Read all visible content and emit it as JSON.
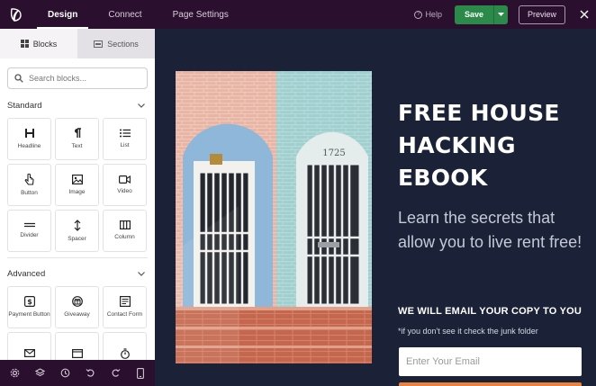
{
  "topbar": {
    "nav": [
      {
        "label": "Design",
        "active": true
      },
      {
        "label": "Connect",
        "active": false
      },
      {
        "label": "Page Settings",
        "active": false
      }
    ],
    "help_label": "Help",
    "save_label": "Save",
    "preview_label": "Preview"
  },
  "sidebar": {
    "tabs": [
      {
        "label": "Blocks",
        "icon": "grid-icon",
        "active": true
      },
      {
        "label": "Sections",
        "icon": "section-icon",
        "active": false
      }
    ],
    "search_placeholder": "Search blocks...",
    "standard": {
      "title": "Standard",
      "blocks": [
        {
          "label": "Headline",
          "icon": "headline-icon"
        },
        {
          "label": "Text",
          "icon": "paragraph-icon"
        },
        {
          "label": "List",
          "icon": "list-icon"
        },
        {
          "label": "Button",
          "icon": "pointer-icon"
        },
        {
          "label": "Image",
          "icon": "image-icon"
        },
        {
          "label": "Video",
          "icon": "video-icon"
        },
        {
          "label": "Divider",
          "icon": "divider-icon"
        },
        {
          "label": "Spacer",
          "icon": "spacer-icon"
        },
        {
          "label": "Column",
          "icon": "column-icon"
        }
      ]
    },
    "advanced": {
      "title": "Advanced",
      "blocks": [
        {
          "label": "Payment Button",
          "icon": "dollar-icon"
        },
        {
          "label": "Giveaway",
          "icon": "giveaway-icon"
        },
        {
          "label": "Contact Form",
          "icon": "form-icon"
        }
      ]
    }
  },
  "canvas": {
    "photo_number": "1725",
    "headline": "FREE HOUSE HACKING EBOOK",
    "subtext": "Learn the secrets that allow you to live rent free!",
    "email_note": "WE WILL EMAIL YOUR COPY TO YOU",
    "junk_note": "*if you don't see it check the junk folder",
    "email_placeholder": "Enter Your Email"
  },
  "colors": {
    "topbar_bg": "#2a0f2e",
    "canvas_bg": "#1b2237",
    "save_green": "#2b8a4a",
    "accent_orange": "#e7833e"
  }
}
